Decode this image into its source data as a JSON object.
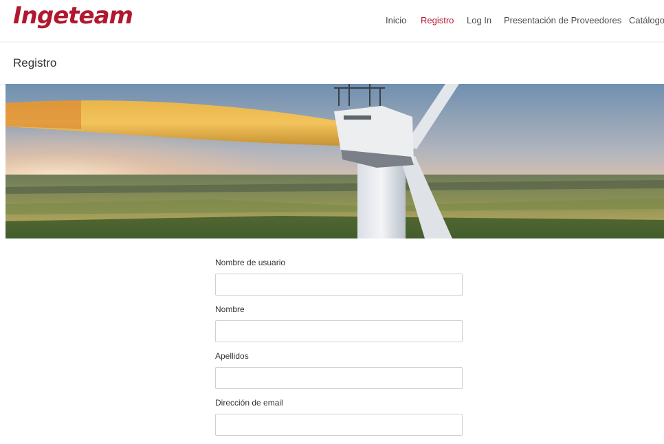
{
  "brand": {
    "logo_text": "Ingeteam",
    "accent": "#b1182f"
  },
  "nav": {
    "items": [
      {
        "label": "Inicio",
        "active": false
      },
      {
        "label": "Registro",
        "active": true
      },
      {
        "label": "Log In",
        "active": false
      },
      {
        "label": "Presentación de Proveedores",
        "active": false
      },
      {
        "label": "Catálogo",
        "active": false
      }
    ]
  },
  "page": {
    "title": "Registro"
  },
  "banner": {
    "icon": "wind-turbine-photo"
  },
  "form": {
    "fields": [
      {
        "label": "Nombre de usuario",
        "value": "",
        "placeholder": ""
      },
      {
        "label": "Nombre",
        "value": "",
        "placeholder": ""
      },
      {
        "label": "Apellidos",
        "value": "",
        "placeholder": ""
      },
      {
        "label": "Dirección de email",
        "value": "",
        "placeholder": ""
      }
    ]
  }
}
